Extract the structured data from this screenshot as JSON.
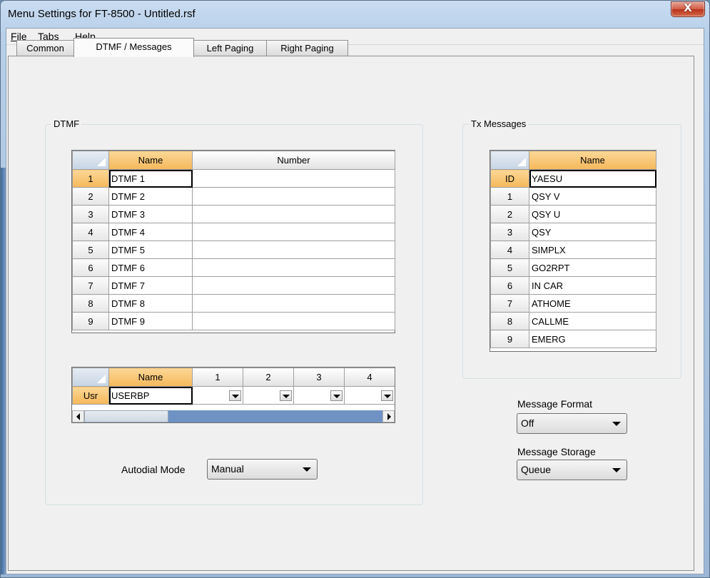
{
  "window": {
    "title": "Menu Settings for FT-8500 - Untitled.rsf",
    "close_glyph": "X"
  },
  "menu": [
    {
      "ul": "F",
      "rest": "ile"
    },
    {
      "ul": "T",
      "rest": "abs"
    },
    {
      "ul": "H",
      "rest": "elp"
    }
  ],
  "tabs": [
    "Common",
    "DTMF / Messages",
    "Left Paging",
    "Right Paging"
  ],
  "active_tab": "DTMF / Messages",
  "dtmf": {
    "group_label": "DTMF",
    "headers": {
      "name": "Name",
      "number": "Number"
    },
    "rows": [
      {
        "id": "1",
        "name": "DTMF 1",
        "number": ""
      },
      {
        "id": "2",
        "name": "DTMF 2",
        "number": ""
      },
      {
        "id": "3",
        "name": "DTMF 3",
        "number": ""
      },
      {
        "id": "4",
        "name": "DTMF 4",
        "number": ""
      },
      {
        "id": "5",
        "name": "DTMF 5",
        "number": ""
      },
      {
        "id": "6",
        "name": "DTMF 6",
        "number": ""
      },
      {
        "id": "7",
        "name": "DTMF 7",
        "number": ""
      },
      {
        "id": "8",
        "name": "DTMF 8",
        "number": ""
      },
      {
        "id": "9",
        "name": "DTMF 9",
        "number": ""
      }
    ],
    "user": {
      "headers": [
        "Name",
        "1",
        "2",
        "3",
        "4"
      ],
      "row_label": "Usr",
      "name": "USERBP"
    },
    "autodial": {
      "label": "Autodial Mode",
      "value": "Manual"
    }
  },
  "tx_messages": {
    "group_label": "Tx Messages",
    "header": "Name",
    "rows": [
      {
        "id": "ID",
        "name": "YAESU"
      },
      {
        "id": "1",
        "name": "QSY V"
      },
      {
        "id": "2",
        "name": "QSY U"
      },
      {
        "id": "3",
        "name": "QSY"
      },
      {
        "id": "4",
        "name": "SIMPLX"
      },
      {
        "id": "5",
        "name": "GO2RPT"
      },
      {
        "id": "6",
        "name": "IN CAR"
      },
      {
        "id": "7",
        "name": "ATHOME"
      },
      {
        "id": "8",
        "name": "CALLME"
      },
      {
        "id": "9",
        "name": "EMERG"
      }
    ]
  },
  "message_format": {
    "label": "Message Format",
    "value": "Off"
  },
  "message_storage": {
    "label": "Message Storage",
    "value": "Queue"
  }
}
